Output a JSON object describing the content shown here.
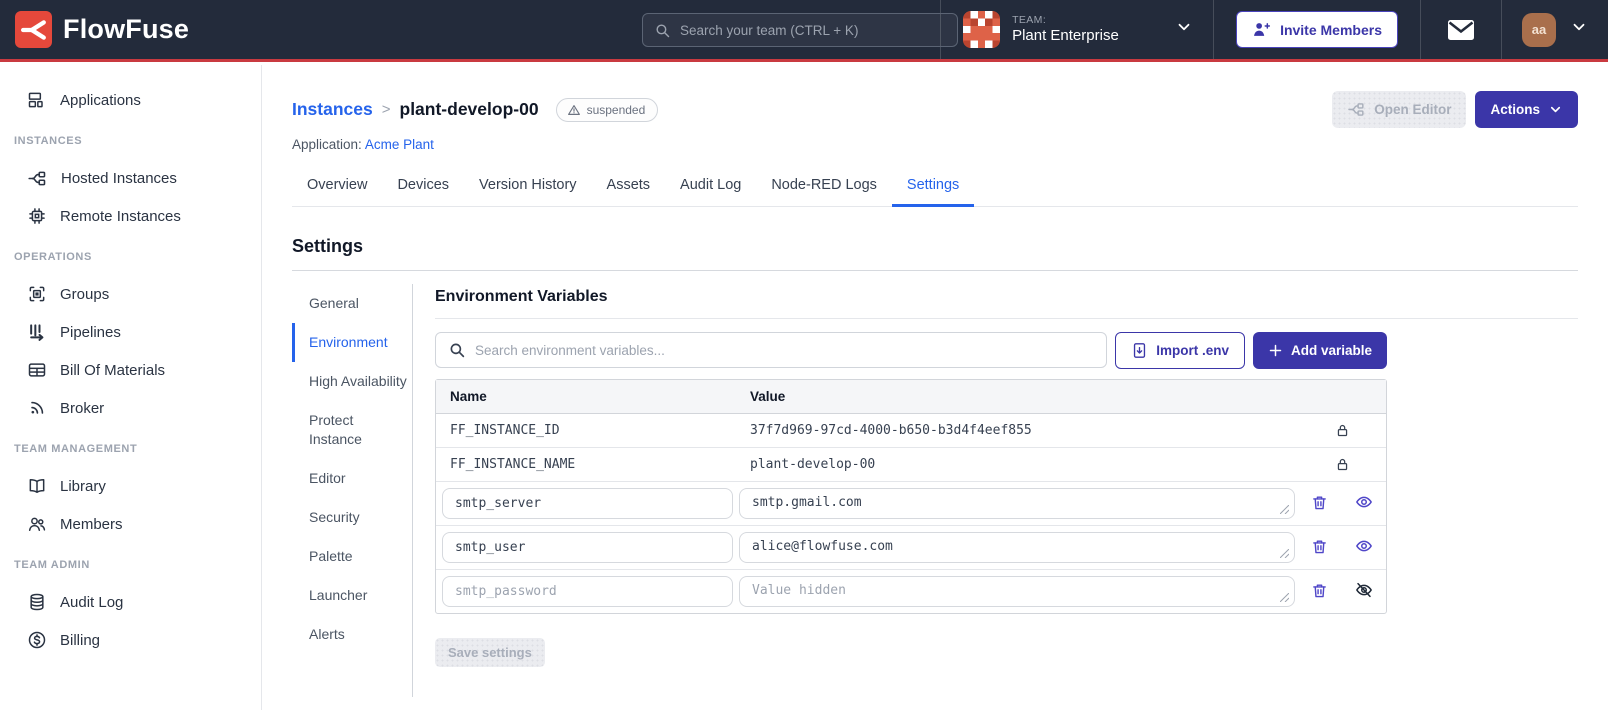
{
  "colors": {
    "navbar_bg": "#232B3B",
    "accent_red": "#C93A40",
    "logo_red": "#E5483B",
    "indigo": "#3B36A8",
    "blue": "#2563EB",
    "team_avatar": "#DE6248",
    "user_avatar": "#A96F4C"
  },
  "navbar": {
    "brand": "FlowFuse",
    "search_placeholder": "Search your team (CTRL + K)",
    "team_label": "TEAM:",
    "team_name": "Plant Enterprise",
    "invite_button": "Invite Members",
    "avatar_initials": "aa"
  },
  "sidebar": {
    "top_item": "Applications",
    "sections": [
      {
        "title": "INSTANCES",
        "items": [
          "Hosted Instances",
          "Remote Instances"
        ]
      },
      {
        "title": "OPERATIONS",
        "items": [
          "Groups",
          "Pipelines",
          "Bill Of Materials",
          "Broker"
        ]
      },
      {
        "title": "TEAM MANAGEMENT",
        "items": [
          "Library",
          "Members"
        ]
      },
      {
        "title": "TEAM ADMIN",
        "items": [
          "Audit Log",
          "Billing"
        ]
      }
    ]
  },
  "header": {
    "breadcrumb_root": "Instances",
    "breadcrumb_separator": ">",
    "instance_name": "plant-develop-00",
    "status_badge": "suspended",
    "application_label": "Application:",
    "application_name": "Acme Plant",
    "open_editor_button": "Open Editor",
    "actions_button": "Actions"
  },
  "tabs": [
    "Overview",
    "Devices",
    "Version History",
    "Assets",
    "Audit Log",
    "Node-RED Logs",
    "Settings"
  ],
  "active_tab": "Settings",
  "settings": {
    "title": "Settings",
    "nav": [
      "General",
      "Environment",
      "High Availability",
      "Protect Instance",
      "Editor",
      "Security",
      "Palette",
      "Launcher",
      "Alerts"
    ],
    "active_nav": "Environment"
  },
  "env": {
    "title": "Environment Variables",
    "search_placeholder": "Search environment variables...",
    "import_button": "Import .env",
    "add_button": "Add variable",
    "columns": {
      "name": "Name",
      "value": "Value"
    },
    "locked_rows": [
      {
        "name": "FF_INSTANCE_ID",
        "value": "37f7d969-97cd-4000-b650-b3d4f4eef855"
      },
      {
        "name": "FF_INSTANCE_NAME",
        "value": "plant-develop-00"
      }
    ],
    "editable_rows": [
      {
        "name": "smtp_server",
        "value": "smtp.gmail.com"
      },
      {
        "name": "smtp_user",
        "value": "alice@flowfuse.com"
      },
      {
        "name": "smtp_password",
        "value": "",
        "value_placeholder": "Value hidden"
      }
    ],
    "save_button": "Save settings"
  }
}
